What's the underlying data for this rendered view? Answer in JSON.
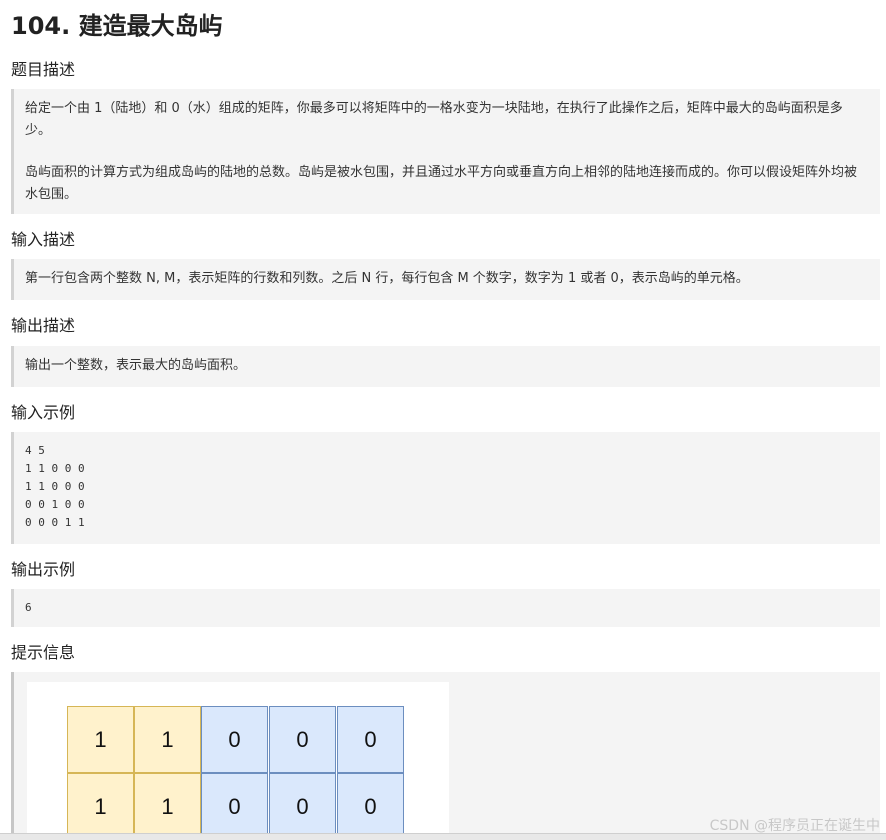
{
  "problem": {
    "title": "104. 建造最大岛屿"
  },
  "sections": {
    "description": {
      "heading": "题目描述",
      "paragraphs": [
        "给定一个由 1（陆地）和 0（水）组成的矩阵，你最多可以将矩阵中的一格水变为一块陆地，在执行了此操作之后，矩阵中最大的岛屿面积是多少。",
        "岛屿面积的计算方式为组成岛屿的陆地的总数。岛屿是被水包围，并且通过水平方向或垂直方向上相邻的陆地连接而成的。你可以假设矩阵外均被水包围。"
      ]
    },
    "input_desc": {
      "heading": "输入描述",
      "text": "第一行包含两个整数 N, M，表示矩阵的行数和列数。之后 N 行，每行包含 M 个数字，数字为 1 或者 0，表示岛屿的单元格。"
    },
    "output_desc": {
      "heading": "输出描述",
      "text": "输出一个整数，表示最大的岛屿面积。"
    },
    "input_example": {
      "heading": "输入示例",
      "lines": [
        "4 5",
        "1 1 0 0 0",
        "1 1 0 0 0",
        "0 0 1 0 0",
        "0 0 0 1 1"
      ]
    },
    "output_example": {
      "heading": "输出示例",
      "lines": [
        "6"
      ]
    },
    "hint": {
      "heading": "提示信息",
      "grid_rows": [
        [
          "1",
          "1",
          "0",
          "0",
          "0"
        ],
        [
          "1",
          "1",
          "0",
          "0",
          "0"
        ]
      ]
    }
  },
  "colors": {
    "land_fill": "#fff2cc",
    "land_border": "#d6b656",
    "water_fill": "#dae8fc",
    "water_border": "#6c8ebf",
    "box_background": "#f4f4f4"
  },
  "watermark": "CSDN @程序员正在诞生中"
}
